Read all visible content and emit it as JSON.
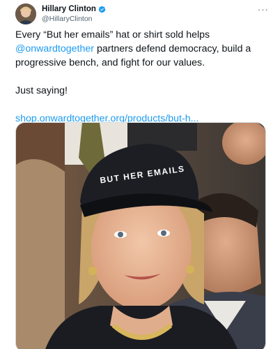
{
  "author": {
    "display_name": "Hillary Clinton",
    "handle": "@HillaryClinton"
  },
  "more_label": "···",
  "tweet": {
    "line1_prefix": "Every “But her emails” hat or shirt sold helps ",
    "mention": "@onwardtogether",
    "line1_suffix": " partners defend democracy, build a progressive bench, and fight for our values.",
    "line2": "Just saying!",
    "url": "shop.onwardtogether.org/products/but-h..."
  },
  "photo": {
    "cap_text": "BUT HER EMAILS"
  },
  "colors": {
    "link": "#1d9bf0",
    "verified": "#1d9bf0",
    "text": "#0f1419",
    "secondary": "#536471"
  }
}
